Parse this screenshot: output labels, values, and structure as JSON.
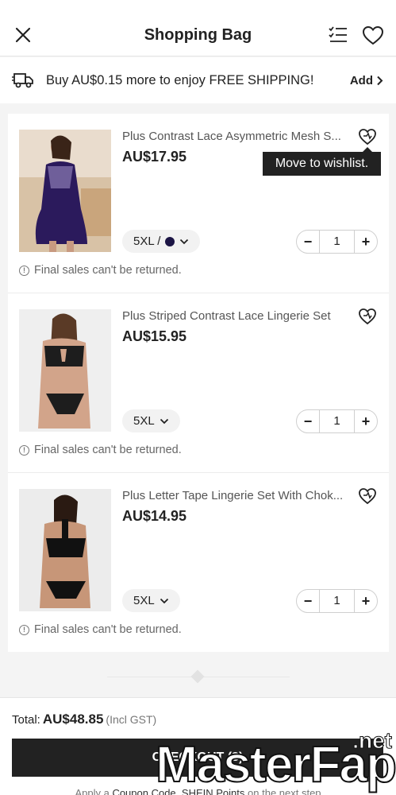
{
  "header": {
    "title": "Shopping Bag",
    "icons": [
      "close-icon",
      "checklist-icon",
      "heart-icon"
    ]
  },
  "shipping": {
    "message": "Buy AU$0.15 more to enjoy FREE SHIPPING!",
    "add_label": "Add",
    "icon": "truck-icon"
  },
  "items": [
    {
      "name": "Plus Contrast Lace Asymmetric Mesh S...",
      "price": "AU$17.95",
      "variant": "5XL /",
      "color_swatch": "#1c1545",
      "quantity": "1",
      "note": "Final sales can't be returned.",
      "tooltip": "Move to wishlist."
    },
    {
      "name": "Plus Striped Contrast Lace Lingerie Set",
      "price": "AU$15.95",
      "variant": "5XL",
      "quantity": "1",
      "note": "Final sales can't be returned."
    },
    {
      "name": "Plus Letter Tape Lingerie Set With Chok...",
      "price": "AU$14.95",
      "variant": "5XL",
      "quantity": "1",
      "note": "Final sales can't be returned."
    }
  ],
  "stepper": {
    "minus": "−",
    "plus": "+"
  },
  "footer": {
    "total_label": "Total:",
    "total_amount": "AU$48.85",
    "total_note": "(Incl GST)",
    "checkout_label": "CHECKOUT (3)",
    "hint_prefix": "Apply a",
    "hint_coupon": "Coupon Code",
    "hint_sep": ",",
    "hint_points": "SHEIN Points",
    "hint_suffix": "on the next step"
  },
  "watermark": {
    "text_a": "Master",
    "text_b": "Fap",
    "suffix": ".net"
  }
}
